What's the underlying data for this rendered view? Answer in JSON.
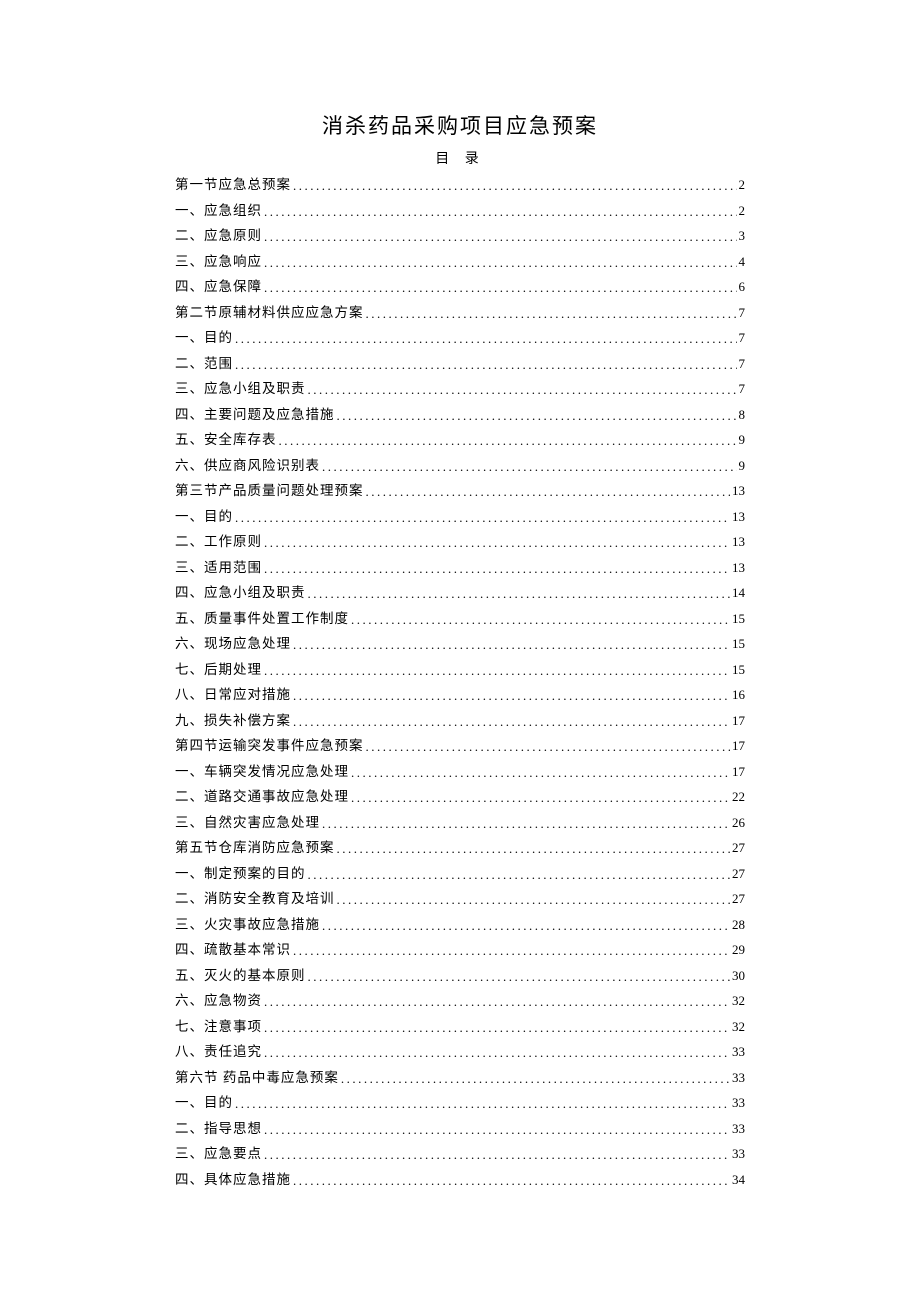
{
  "title": "消杀药品采购项目应急预案",
  "tocLabel": "目 录",
  "toc": [
    {
      "text": "第一节应急总预案",
      "page": "2"
    },
    {
      "text": "一、应急组织",
      "page": "2"
    },
    {
      "text": "二、应急原则",
      "page": "3"
    },
    {
      "text": "三、应急响应",
      "page": "4"
    },
    {
      "text": "四、应急保障",
      "page": "6"
    },
    {
      "text": "第二节原辅材料供应应急方案",
      "page": "7"
    },
    {
      "text": "一、目的",
      "page": "7"
    },
    {
      "text": "二、范围",
      "page": "7"
    },
    {
      "text": "三、应急小组及职责",
      "page": "7"
    },
    {
      "text": "四、主要问题及应急措施",
      "page": "8"
    },
    {
      "text": "五、安全库存表",
      "page": "9"
    },
    {
      "text": "六、供应商风险识别表",
      "page": "9"
    },
    {
      "text": "第三节产品质量问题处理预案",
      "page": "13"
    },
    {
      "text": "一、目的",
      "page": "13"
    },
    {
      "text": "二、工作原则",
      "page": "13"
    },
    {
      "text": "三、适用范围",
      "page": "13"
    },
    {
      "text": "四、应急小组及职责",
      "page": "14"
    },
    {
      "text": "五、质量事件处置工作制度",
      "page": "15"
    },
    {
      "text": "六、现场应急处理",
      "page": "15"
    },
    {
      "text": "七、后期处理",
      "page": "15"
    },
    {
      "text": "八、日常应对措施",
      "page": "16"
    },
    {
      "text": "九、损失补偿方案",
      "page": "17"
    },
    {
      "text": "第四节运输突发事件应急预案",
      "page": "17"
    },
    {
      "text": "一、车辆突发情况应急处理",
      "page": "17"
    },
    {
      "text": "二、道路交通事故应急处理",
      "page": "22"
    },
    {
      "text": "三、自然灾害应急处理",
      "page": "26"
    },
    {
      "text": "第五节仓库消防应急预案",
      "page": "27"
    },
    {
      "text": "一、制定预案的目的",
      "page": "27"
    },
    {
      "text": "二、消防安全教育及培训",
      "page": "27"
    },
    {
      "text": "三、火灾事故应急措施",
      "page": "28"
    },
    {
      "text": "四、疏散基本常识",
      "page": "29"
    },
    {
      "text": "五、灭火的基本原则",
      "page": "30"
    },
    {
      "text": "六、应急物资",
      "page": "32"
    },
    {
      "text": "七、注意事项",
      "page": "32"
    },
    {
      "text": "八、责任追究",
      "page": "33"
    },
    {
      "text": "第六节 药品中毒应急预案",
      "page": "33"
    },
    {
      "text": "一、目的",
      "page": "33"
    },
    {
      "text": "二、指导思想",
      "page": "33"
    },
    {
      "text": "三、应急要点",
      "page": "33"
    },
    {
      "text": "四、具体应急措施",
      "page": "34"
    }
  ]
}
